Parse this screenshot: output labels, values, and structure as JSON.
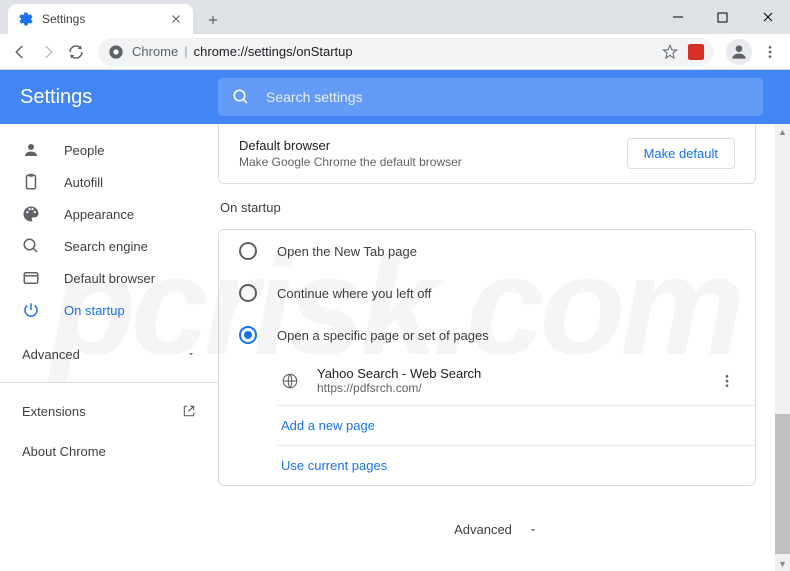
{
  "tab": {
    "title": "Settings"
  },
  "omnibox": {
    "protocol": "Chrome",
    "path": "chrome://settings/onStartup"
  },
  "header": {
    "title": "Settings",
    "search_placeholder": "Search settings"
  },
  "sidebar": {
    "items": [
      {
        "label": "People"
      },
      {
        "label": "Autofill"
      },
      {
        "label": "Appearance"
      },
      {
        "label": "Search engine"
      },
      {
        "label": "Default browser"
      },
      {
        "label": "On startup"
      }
    ],
    "advanced": "Advanced",
    "extensions": "Extensions",
    "about": "About Chrome"
  },
  "default_browser": {
    "title": "Default browser",
    "subtitle": "Make Google Chrome the default browser",
    "button": "Make default"
  },
  "startup": {
    "title": "On startup",
    "opt_newtab": "Open the New Tab page",
    "opt_continue": "Continue where you left off",
    "opt_specific": "Open a specific page or set of pages",
    "page_title": "Yahoo Search - Web Search",
    "page_url": "https://pdfsrch.com/",
    "add_page": "Add a new page",
    "use_current": "Use current pages"
  },
  "footer": {
    "advanced": "Advanced"
  },
  "watermark": "pcrisk.com"
}
